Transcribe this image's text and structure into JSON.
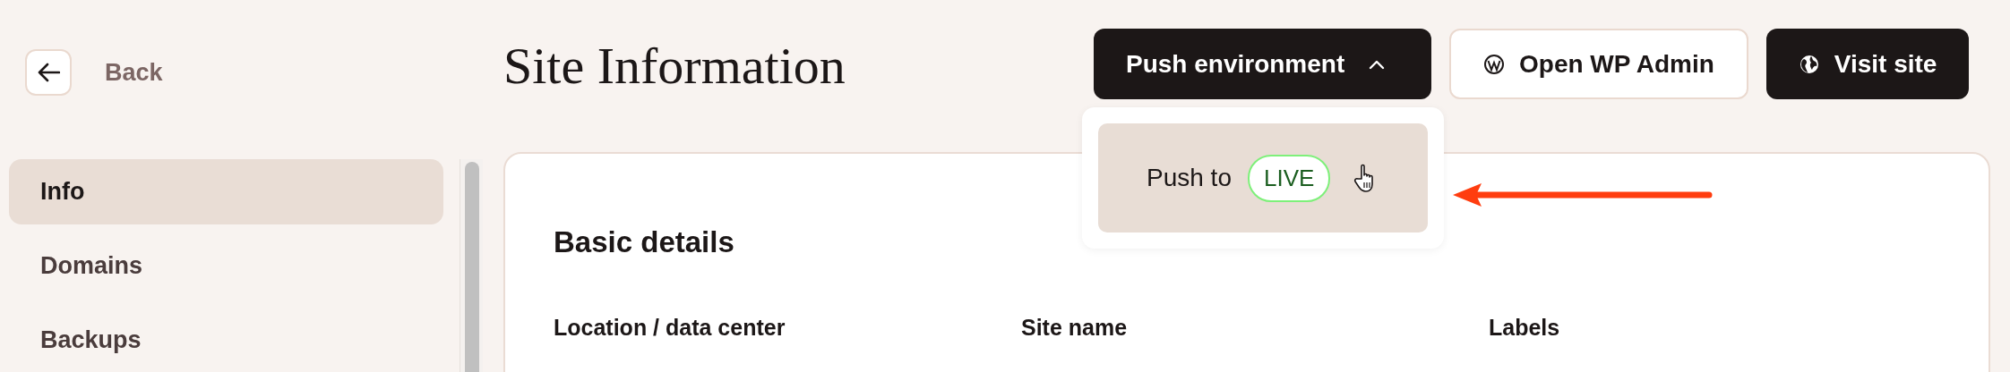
{
  "back": {
    "label": "Back"
  },
  "title": "Site Information",
  "actions": [
    {
      "label": "Push environment",
      "kind": "dropdown",
      "expanded": true
    },
    {
      "label": "Open WP Admin",
      "kind": "wordpress"
    },
    {
      "label": "Visit site",
      "kind": "globe"
    }
  ],
  "dropdown": {
    "items": [
      {
        "label": "Push to",
        "badge": "LIVE"
      }
    ]
  },
  "sidebar": {
    "items": [
      {
        "label": "Info",
        "selected": true
      },
      {
        "label": "Domains",
        "selected": false
      },
      {
        "label": "Backups",
        "selected": false
      }
    ]
  },
  "card": {
    "heading": "Basic details",
    "columns": [
      "Location / data center",
      "Site name",
      "Labels"
    ]
  }
}
